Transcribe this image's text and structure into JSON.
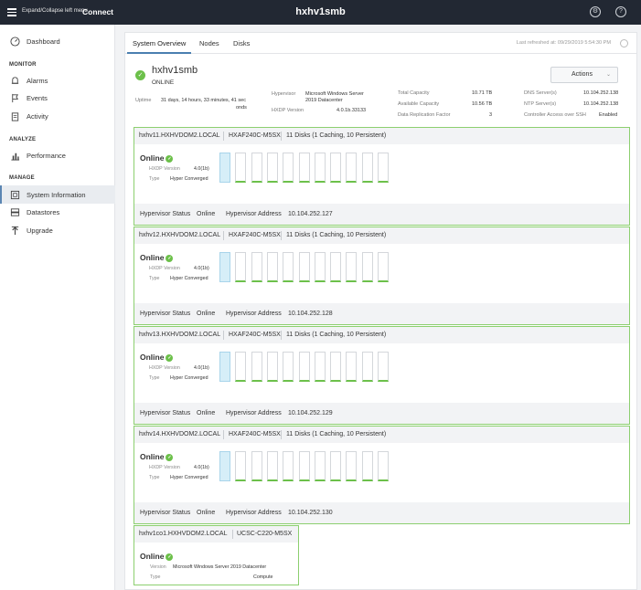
{
  "topbar": {
    "collapse_label": "Expand/Collapse left menu",
    "brand": "Connect",
    "cluster_name": "hxhv1smb"
  },
  "sidebar": {
    "dashboard": "Dashboard",
    "monitor_section": "MONITOR",
    "alarms": "Alarms",
    "events": "Events",
    "activity": "Activity",
    "analyze_section": "ANALYZE",
    "performance": "Performance",
    "manage_section": "MANAGE",
    "system_information": "System Information",
    "datastores": "Datastores",
    "upgrade": "Upgrade"
  },
  "tabs": {
    "overview": "System Overview",
    "nodes": "Nodes",
    "disks": "Disks"
  },
  "refresh_text": "Last refreshed at: 09/29/2019 5:54:30 PM",
  "system": {
    "name": "hxhv1smb",
    "state": "ONLINE",
    "actions_label": "Actions",
    "uptime_label": "Uptime",
    "uptime_value_1": "31 days, 14 hours, 33 minutes, 41 sec",
    "uptime_value_2": "onds",
    "hypervisor_label": "Hypervisor",
    "hypervisor_value_1": "Microsoft Windows Server",
    "hypervisor_value_2": "2019 Datacenter",
    "hxdp_label": "HXDP Version",
    "hxdp_value": "4.0.1b.33133",
    "total_capacity_label": "Total Capacity",
    "total_capacity_value": "10.71 TB",
    "available_capacity_label": "Available Capacity",
    "available_capacity_value": "10.56 TB",
    "replication_label": "Data Replication Factor",
    "replication_value": "3",
    "dns_label": "DNS Server(s)",
    "dns_value": "10.104.252.138",
    "ntp_label": "NTP Server(s)",
    "ntp_value": "10.104.252.138",
    "ssh_label": "Controller Access over SSH",
    "ssh_value": "Enabled"
  },
  "node_common": {
    "online": "Online",
    "hxdp_label": "HXDP Version",
    "hxdp_value": "4.0(1b)",
    "type_label": "Type",
    "type_value": "Hyper Converged",
    "hv_status_label": "Hypervisor Status",
    "hv_status_value": "Online",
    "hv_address_label": "Hypervisor Address",
    "model": "HXAF240C-M5SX",
    "disks_summary": "11 Disks (1 Caching, 10 Persistent)"
  },
  "nodes": [
    {
      "hostname": "hxhv11.HXHVDOM2.LOCAL",
      "address": "10.104.252.127"
    },
    {
      "hostname": "hxhv12.HXHVDOM2.LOCAL",
      "address": "10.104.252.128"
    },
    {
      "hostname": "hxhv13.HXHVDOM2.LOCAL",
      "address": "10.104.252.129"
    },
    {
      "hostname": "hxhv14.HXHVDOM2.LOCAL",
      "address": "10.104.252.130"
    }
  ],
  "compute_node": {
    "hostname": "hxhv1co1.HXHVDOM2.LOCAL",
    "model": "UCSC-C220-M5SX",
    "online": "Online",
    "version_label": "Version",
    "version_value": "Microsoft Windows Server 2019 Datacenter",
    "type_label": "Type",
    "type_value": "Compute"
  },
  "colors": {
    "online_green": "#6cc04a",
    "card_border": "#8ccf6f",
    "topbar": "#222833"
  }
}
